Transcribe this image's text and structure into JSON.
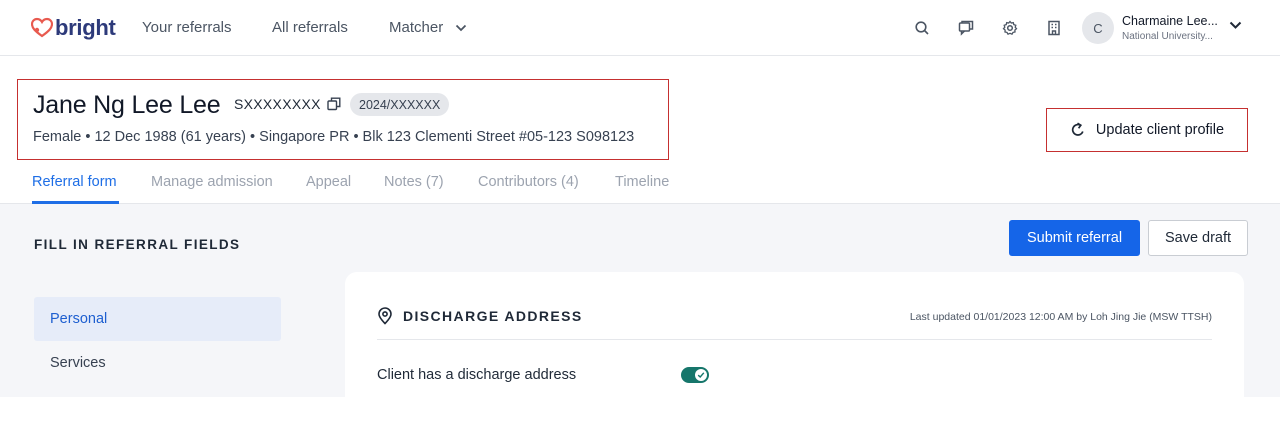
{
  "brand": {
    "name": "bright",
    "color": "#e85a4f",
    "text_color": "#2d3a7a"
  },
  "nav": {
    "links": [
      "Your referrals",
      "All referrals",
      "Matcher"
    ],
    "icons": [
      "search-icon",
      "chat-icon",
      "gear-icon",
      "building-icon"
    ],
    "user": {
      "initial": "C",
      "name": "Charmaine Lee...",
      "org": "National University..."
    }
  },
  "client": {
    "name": "Jane Ng Lee Lee",
    "id_masked": "SXXXXXXXX",
    "case_no": "2024/XXXXXX",
    "details": "Female • 12 Dec 1988 (61 years) • Singapore PR • Blk 123 Clementi Street #05-123 S098123"
  },
  "update_button": {
    "label": "Update client profile"
  },
  "tabs": [
    {
      "label": "Referral form",
      "active": true
    },
    {
      "label": "Manage admission",
      "active": false
    },
    {
      "label": "Appeal",
      "active": false
    },
    {
      "label": "Notes (7)",
      "active": false
    },
    {
      "label": "Contributors (4)",
      "active": false
    },
    {
      "label": "Timeline",
      "active": false
    }
  ],
  "form": {
    "section_title": "FILL IN REFERRAL FIELDS",
    "submit_label": "Submit referral",
    "draft_label": "Save draft",
    "sidebar": [
      {
        "label": "Personal",
        "active": true
      },
      {
        "label": "Services",
        "active": false
      }
    ]
  },
  "card": {
    "title": "DISCHARGE ADDRESS",
    "updated": "Last updated 01/01/2023 12:00 AM by Loh Jing Jie (MSW TTSH)",
    "field_label": "Client has a discharge address",
    "toggle_on": true
  },
  "colors": {
    "primary": "#1565e8",
    "highlight_border": "#c53030",
    "toggle": "#16766b",
    "content_bg": "#f5f6f9"
  }
}
